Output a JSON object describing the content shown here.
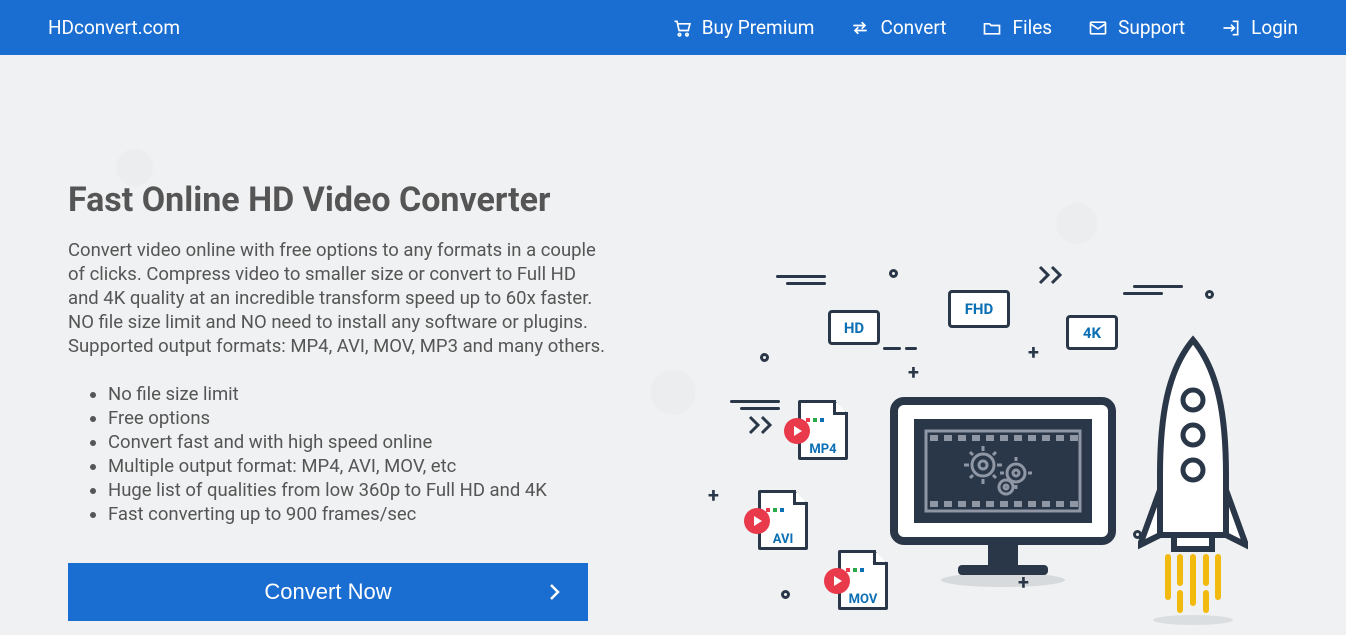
{
  "header": {
    "logo": "HDconvert.com",
    "nav": [
      {
        "label": "Buy Premium",
        "icon": "cart"
      },
      {
        "label": "Convert",
        "icon": "transfer"
      },
      {
        "label": "Files",
        "icon": "folder"
      },
      {
        "label": "Support",
        "icon": "mail"
      },
      {
        "label": "Login",
        "icon": "login"
      }
    ]
  },
  "hero": {
    "title": "Fast Online HD Video Converter",
    "description": "Convert video online with free options to any formats in a couple of clicks. Compress video to smaller size or convert to Full HD and 4K quality at an incredible transform speed up to 60x faster. NO file size limit and NO need to install any software or plugins. Supported output formats: MP4, AVI, MOV, MP3 and many others.",
    "features": [
      "No file size limit",
      "Free options",
      "Convert fast and with high speed online",
      "Multiple output format: MP4, AVI, MOV, etc",
      "Huge list of qualities from low 360p to Full HD and 4K",
      "Fast converting up to 900 frames/sec"
    ],
    "cta": "Convert Now"
  },
  "illus": {
    "badges": {
      "hd": "HD",
      "fhd": "FHD",
      "fourk": "4K"
    },
    "files": {
      "mp4": "MP4",
      "avi": "AVI",
      "mov": "MOV"
    }
  }
}
